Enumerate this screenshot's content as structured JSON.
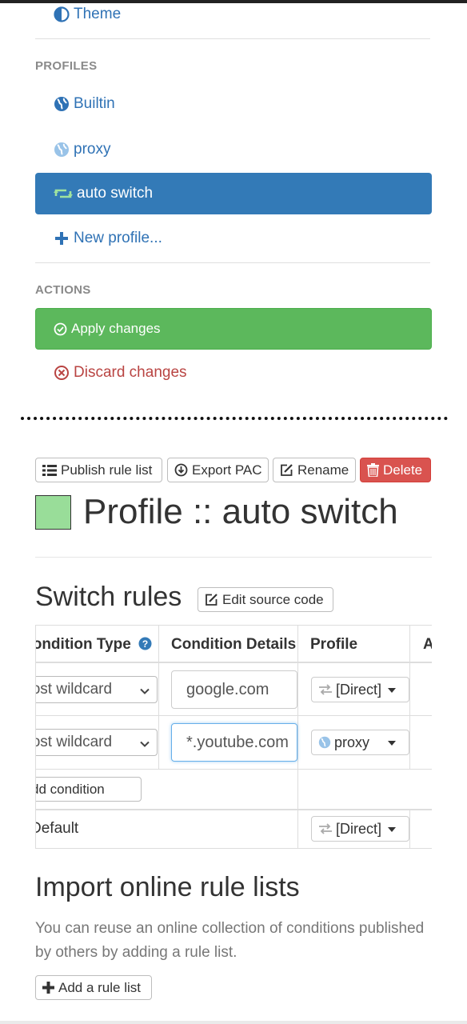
{
  "colors": {
    "primary": "#337ab7",
    "success": "#5cb85c",
    "danger": "#d9534f",
    "info": "#5bc0de",
    "profile_color": "#99dd99"
  },
  "sidebar": {
    "theme_label": "Theme",
    "profiles_heading": "PROFILES",
    "profiles": [
      {
        "label": "Builtin",
        "icon": "globe-icon"
      },
      {
        "label": "proxy",
        "icon": "globe-icon"
      },
      {
        "label": "auto switch",
        "icon": "retweet-icon",
        "active": true
      }
    ],
    "new_profile_label": "New profile...",
    "actions_heading": "ACTIONS",
    "apply_label": "Apply changes",
    "discard_label": "Discard changes"
  },
  "toolbar": {
    "publish_label": "Publish rule list",
    "export_label": "Export PAC",
    "rename_label": "Rename",
    "delete_label": "Delete"
  },
  "profile": {
    "title": "Profile :: auto switch"
  },
  "switch_rules": {
    "heading": "Switch rules",
    "edit_source_label": "Edit source code",
    "columns": [
      "Condition Type",
      "Condition Details",
      "Profile",
      "Actions"
    ],
    "rules": [
      {
        "type": "Host wildcard",
        "details": "google.com",
        "profile": "[Direct]"
      },
      {
        "type": "Host wildcard",
        "details": "*.youtube.com",
        "profile": "proxy"
      }
    ],
    "add_condition_label": "+ Add condition",
    "default_label": "Default",
    "default_profile": "[Direct]"
  },
  "import": {
    "heading": "Import online rule lists",
    "description": "You can reuse an online collection of conditions published by others by adding a rule list.",
    "add_rule_list_label": "Add a rule list"
  }
}
